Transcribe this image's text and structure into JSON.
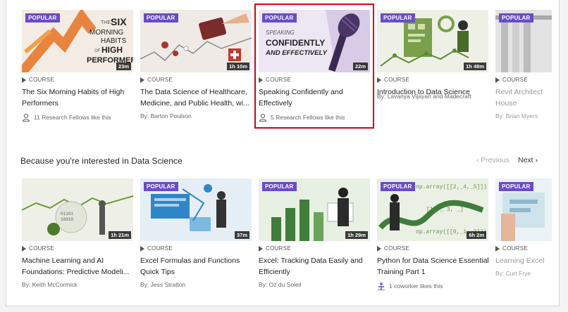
{
  "row1": [
    {
      "badge": "POPULAR",
      "duration": "23m",
      "type": "COURSE",
      "title1": "The Six Morning Habits of High",
      "title2": "Performers",
      "likes": "11 Research Fellows like this",
      "thumb_text": [
        "THE",
        "SIX",
        "MORNING",
        "HABITS",
        "OF",
        "HIGH",
        "PERFORMERS"
      ]
    },
    {
      "badge": "POPULAR",
      "duration": "1h 10m",
      "type": "COURSE",
      "title1": "The Data Science of Healthcare,",
      "title2": "Medicine, and Public Health, wi...",
      "author": "By: Barton Poulson"
    },
    {
      "badge": "POPULAR",
      "duration": "22m",
      "type": "COURSE",
      "title1": "Speaking Confidently and",
      "title2": "Effectively",
      "likes": "5 Research Fellows like this",
      "thumb_text": [
        "SPEAKING",
        "CONFIDENTLY",
        "AND EFFECTIVELY"
      ]
    },
    {
      "badge": "POPULAR",
      "duration": "1h 48m",
      "type": "COURSE",
      "title1": "Introduction to Data Science",
      "title2": "",
      "author": "By: Lavanya Vijayan and Madecraft"
    },
    {
      "badge": "POPULAR",
      "type": "COURSE",
      "title1": "Revit Architect",
      "title2": "House",
      "author": "By: Brian Myers"
    }
  ],
  "section": {
    "title": "Because you're interested in Data Science",
    "prev": "Previous",
    "next": "Next"
  },
  "row2": [
    {
      "duration": "1h 21m",
      "type": "COURSE",
      "title1": "Machine Learning and AI",
      "title2": "Foundations: Predictive Modeli...",
      "author": "By: Keith McCormick"
    },
    {
      "badge": "POPULAR",
      "duration": "37m",
      "type": "COURSE",
      "title1": "Excel Formulas and Functions",
      "title2": "Quick Tips",
      "author": "By: Jess Stratton"
    },
    {
      "badge": "POPULAR",
      "duration": "1h 29m",
      "type": "COURSE",
      "title1": "Excel: Tracking Data Easily and",
      "title2": "Efficiently",
      "author": "By: Oz du Soleil"
    },
    {
      "badge": "POPULAR",
      "duration": "6h 2m",
      "type": "COURSE",
      "title1": "Python for Data Science Essential",
      "title2": "Training Part 1",
      "likes": "1 coworker likes this",
      "thumb_code": [
        "np.array([[2,_4,_5]])",
        "[10,_ 3, _]",
        "np.array([[0,_1,_2]])"
      ]
    },
    {
      "badge": "POPULAR",
      "type": "COURSE",
      "title1": "Learning Excel",
      "title2": "",
      "author": "By: Curt Frye"
    }
  ],
  "colors": {
    "badge": "#6a4cc9",
    "highlight": "#d0021b"
  }
}
